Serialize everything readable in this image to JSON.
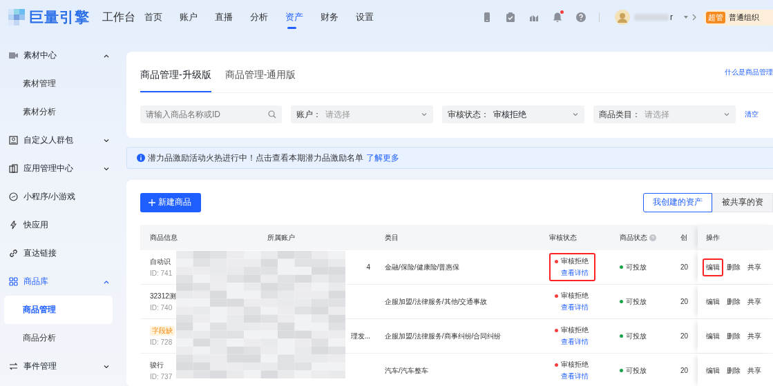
{
  "header": {
    "logo": "巨量引擎",
    "app": "工作台",
    "nav": [
      {
        "label": "首页",
        "selected": false
      },
      {
        "label": "账户",
        "selected": false
      },
      {
        "label": "直播",
        "selected": false
      },
      {
        "label": "分析",
        "selected": false
      },
      {
        "label": "资产",
        "selected": true
      },
      {
        "label": "财务",
        "selected": false
      },
      {
        "label": "设置",
        "selected": false
      }
    ],
    "notification_dot": true,
    "user_name_tail": "r",
    "org_badge": "超管",
    "org_name": "普通组织"
  },
  "sidebar": {
    "items": [
      {
        "label": "素材中心",
        "selected": false,
        "expanded": true,
        "children": [
          {
            "label": "素材管理",
            "selected": false
          },
          {
            "label": "素材分析",
            "selected": false
          }
        ]
      },
      {
        "label": "自定义人群包",
        "selected": false,
        "expanded": false
      },
      {
        "label": "应用管理中心",
        "selected": false,
        "expanded": false
      },
      {
        "label": "小程序/小游戏",
        "selected": false
      },
      {
        "label": "快应用",
        "selected": false
      },
      {
        "label": "直达链接",
        "selected": false
      },
      {
        "label": "商品库",
        "selected": true,
        "expanded": true,
        "children": [
          {
            "label": "商品管理",
            "selected": true
          },
          {
            "label": "商品分析",
            "selected": false
          }
        ]
      },
      {
        "label": "事件管理",
        "selected": false,
        "expanded": false
      }
    ]
  },
  "tabs": [
    {
      "label": "商品管理-升级版",
      "selected": true
    },
    {
      "label": "商品管理-通用版",
      "selected": false
    }
  ],
  "help_link": "什么是商品管理",
  "filters": {
    "search": {
      "placeholder": "请输入商品名称或ID"
    },
    "selects": [
      {
        "label": "账户：",
        "placeholder": "请选择"
      },
      {
        "label": "审核状态：",
        "value": "审核拒绝"
      },
      {
        "label": "商品类目：",
        "placeholder": "请选择"
      }
    ],
    "clear": "清空"
  },
  "notice": {
    "text": "潜力品激励活动火热进行中！点击查看本期潜力品激励名单",
    "link": "了解更多"
  },
  "create_button": "新建商品",
  "scope_tabs": [
    {
      "label": "我创建的资产",
      "selected": true
    },
    {
      "label": "被共享的资",
      "selected": false
    }
  ],
  "table": {
    "columns": [
      {
        "label": "商品信息"
      },
      {
        "label": "所属账户"
      },
      {
        "label": "类目"
      },
      {
        "label": "审核状态"
      },
      {
        "label": "商品状态",
        "help": true
      },
      {
        "label": "创"
      },
      {
        "label": "操作"
      }
    ],
    "rows": [
      {
        "name": "自动识",
        "id": "ID: 741",
        "account": "4",
        "category": "金融/保险/健康险/普惠保",
        "review": {
          "status": "审核拒绝",
          "color": "#f53f3f",
          "link": "查看详情",
          "highlighted": true
        },
        "state": {
          "status": "可投放",
          "color": "#1aa34a"
        },
        "created": "20",
        "actions": [
          {
            "label": "编辑",
            "highlighted": true
          },
          {
            "label": "删除",
            "highlighted": false
          },
          {
            "label": "共享",
            "highlighted": false
          }
        ]
      },
      {
        "name": "32312测",
        "id": "ID: 740",
        "category": "企服加盟/法律服务/其他/交通事故",
        "review": {
          "status": "审核拒绝",
          "color": "#f53f3f",
          "link": "查看详情",
          "highlighted": false
        },
        "state": {
          "status": "可投放",
          "color": "#1aa34a"
        },
        "created": "20",
        "actions": [
          {
            "label": "编辑",
            "highlighted": false
          },
          {
            "label": "删除",
            "highlighted": false
          },
          {
            "label": "共享",
            "highlighted": false
          }
        ]
      },
      {
        "tag": "字段缺",
        "id": "ID: 728",
        "account": "理发...",
        "category": "企服加盟/法律服务/商事纠纷/合同纠纷",
        "review": {
          "status": "审核拒绝",
          "color": "#f53f3f",
          "link": "查看详情",
          "highlighted": false
        },
        "state": {
          "status": "可投放",
          "color": "#1aa34a"
        },
        "created": "20",
        "actions": [
          {
            "label": "编辑",
            "highlighted": false
          },
          {
            "label": "删除",
            "highlighted": false
          },
          {
            "label": "共享",
            "highlighted": false
          }
        ]
      },
      {
        "name": "骏行",
        "id": "ID: 737",
        "category": "汽车/汽车整车",
        "review": {
          "status": "审核拒绝",
          "color": "#f53f3f",
          "link": "查看详情",
          "highlighted": false
        },
        "state": {
          "status": "可投放",
          "color": "#1aa34a"
        },
        "created": "20",
        "actions": [
          {
            "label": "编辑",
            "highlighted": false
          },
          {
            "label": "删除",
            "highlighted": false
          },
          {
            "label": "共享",
            "highlighted": false
          }
        ]
      }
    ]
  }
}
